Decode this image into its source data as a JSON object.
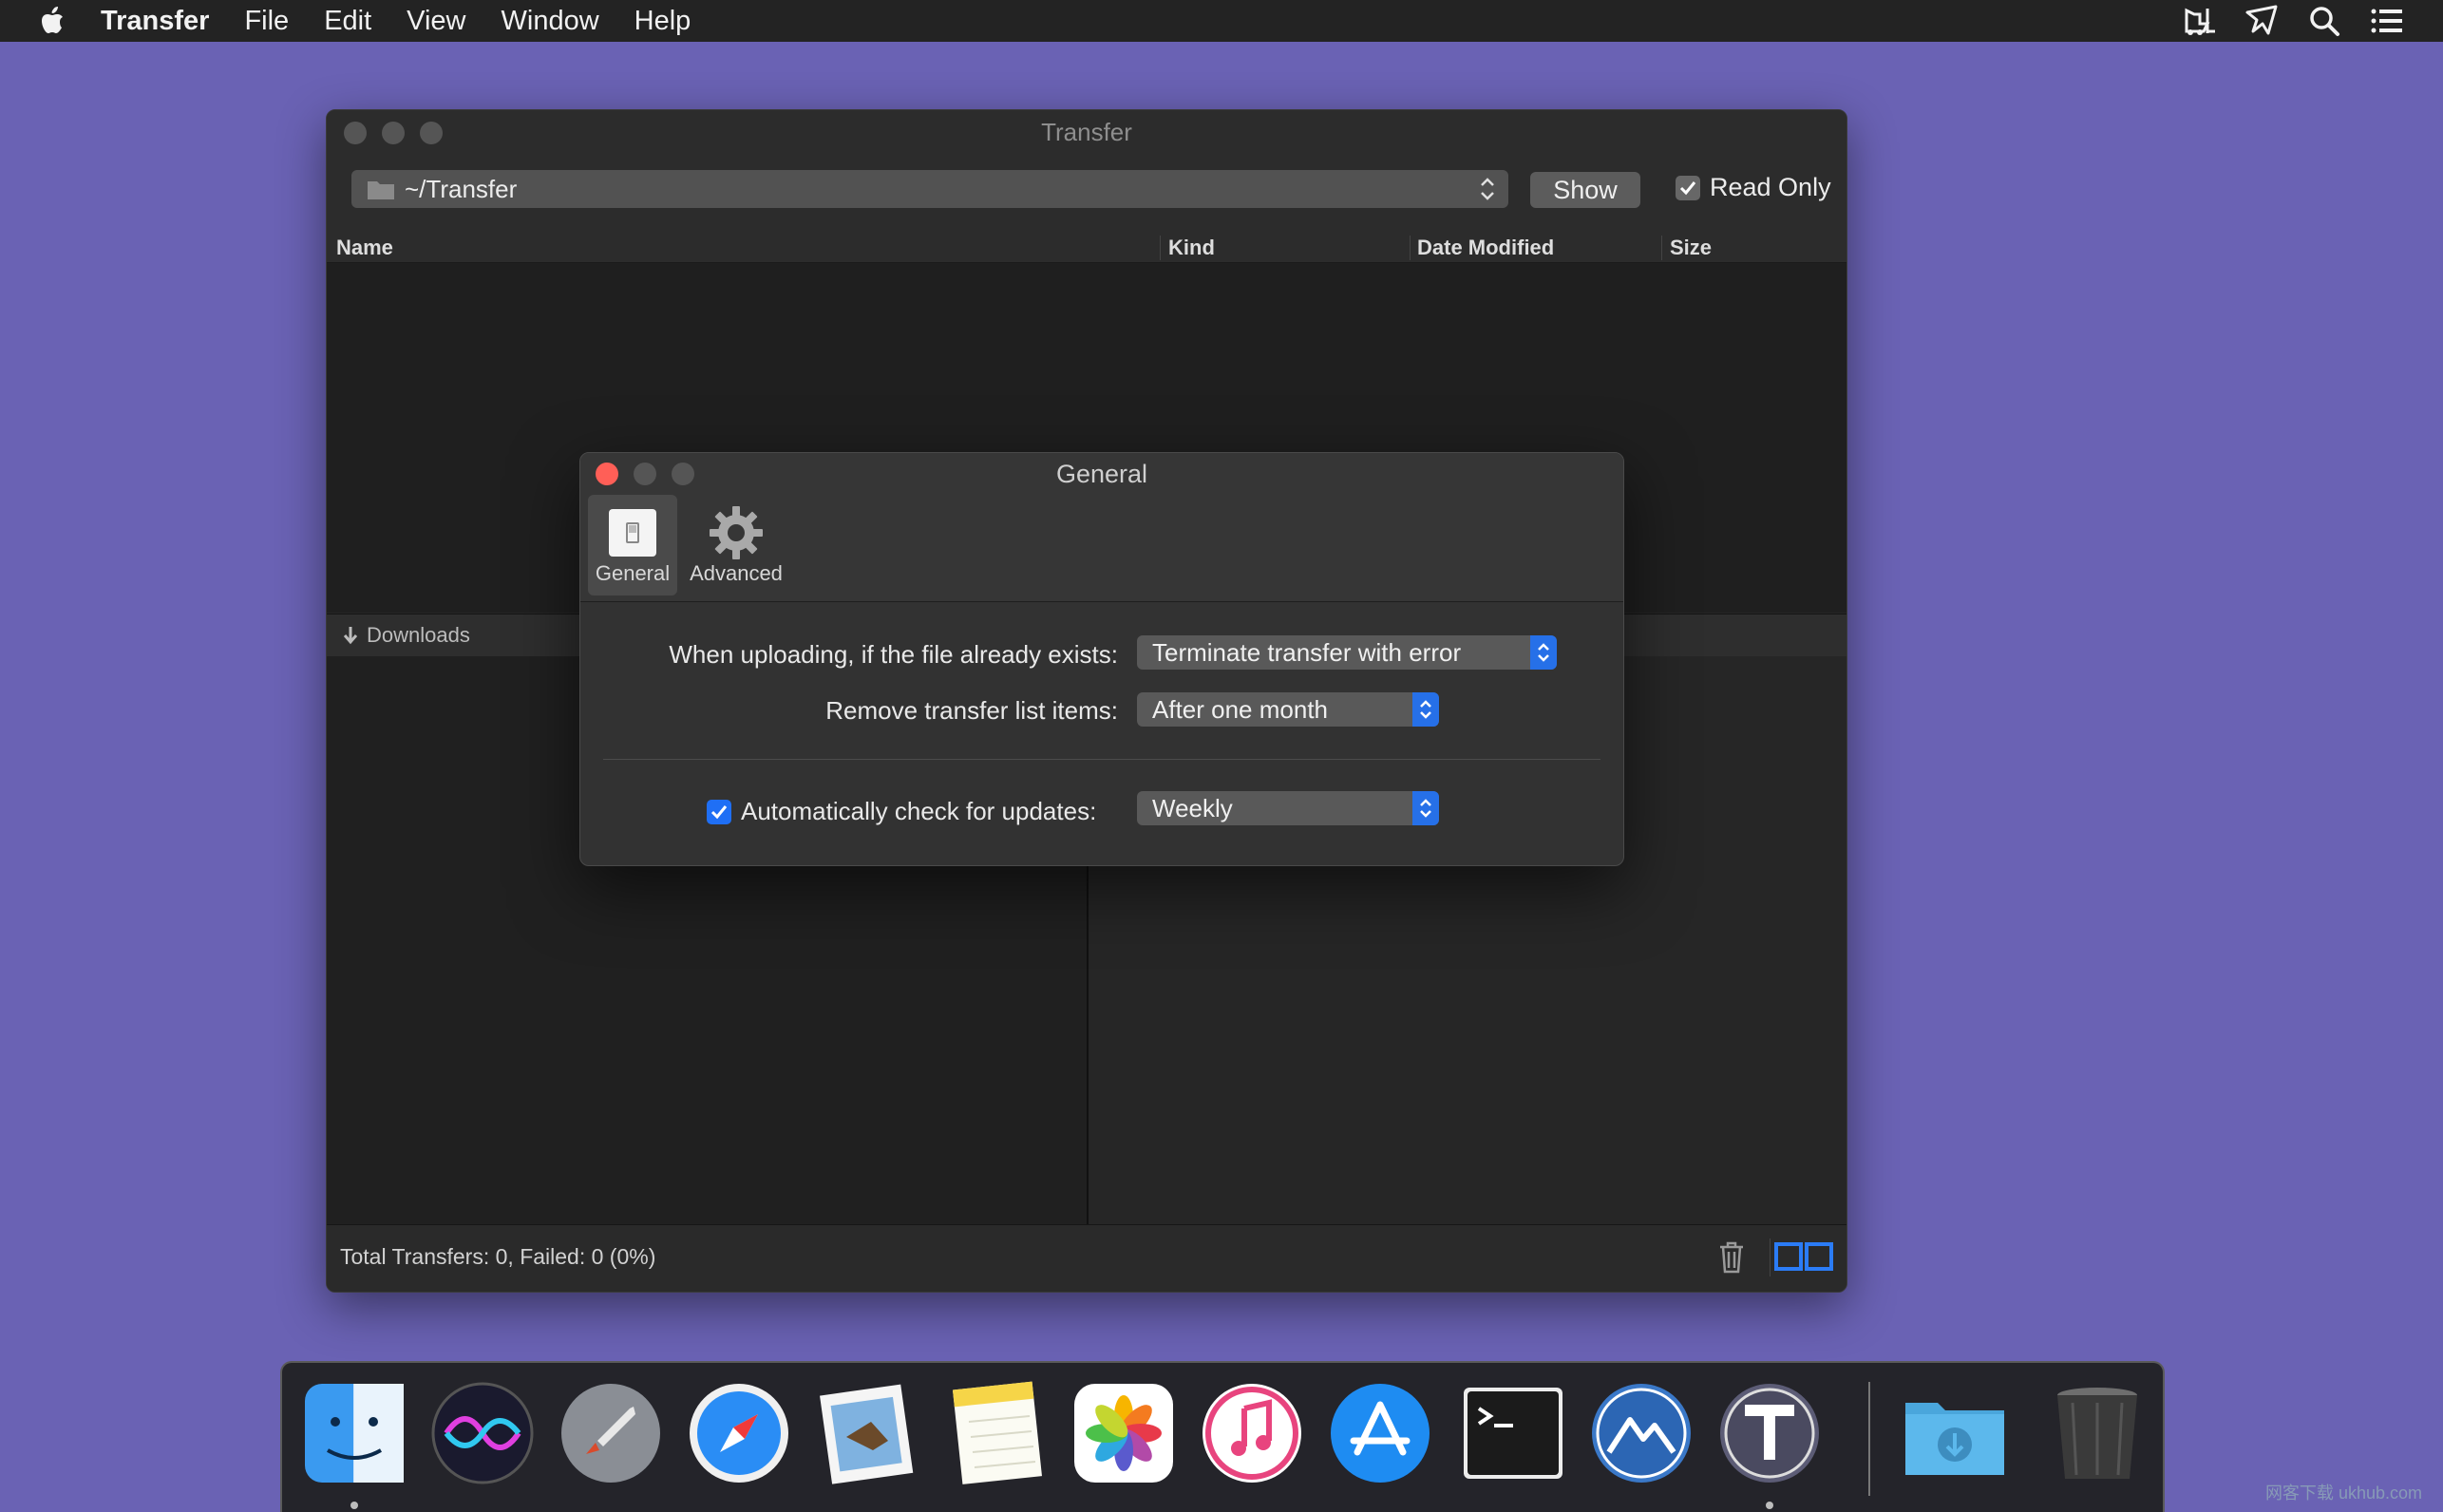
{
  "menubar": {
    "app_name": "Transfer",
    "items": [
      "File",
      "Edit",
      "View",
      "Window",
      "Help"
    ],
    "status_icons": [
      "forklift-icon",
      "plane-icon",
      "search-icon",
      "list-icon"
    ]
  },
  "window": {
    "title": "Transfer",
    "path": "~/Transfer",
    "show_label": "Show",
    "read_only_label": "Read Only",
    "read_only_checked": true,
    "columns": [
      "Name",
      "Kind",
      "Date Modified",
      "Size"
    ],
    "downloads_label": "Downloads",
    "status_text": "Total Transfers: 0, Failed: 0 (0%)"
  },
  "prefs": {
    "title": "General",
    "tabs": [
      {
        "label": "General",
        "icon": "switch-icon",
        "selected": true
      },
      {
        "label": "Advanced",
        "icon": "gear-icon",
        "selected": false
      }
    ],
    "upload_exists_label": "When uploading, if the file already exists:",
    "upload_exists_value": "Terminate transfer with error",
    "remove_items_label": "Remove transfer list items:",
    "remove_items_value": "After one month",
    "auto_update_label": "Automatically check for updates:",
    "auto_update_checked": true,
    "auto_update_value": "Weekly"
  },
  "dock": {
    "apps": [
      "finder-icon",
      "siri-icon",
      "launchpad-icon",
      "safari-icon",
      "mail-icon",
      "notes-icon",
      "photos-icon",
      "itunes-icon",
      "app-store-icon",
      "terminal-icon",
      "mountain-app-icon",
      "transfer-app-icon",
      "downloads-folder-icon",
      "trash-icon"
    ]
  },
  "watermark": "网客下载 ukhub.com",
  "colors": {
    "desktop": "#6a62b4",
    "accent": "#2670e8",
    "close_red": "#ff5f57"
  }
}
